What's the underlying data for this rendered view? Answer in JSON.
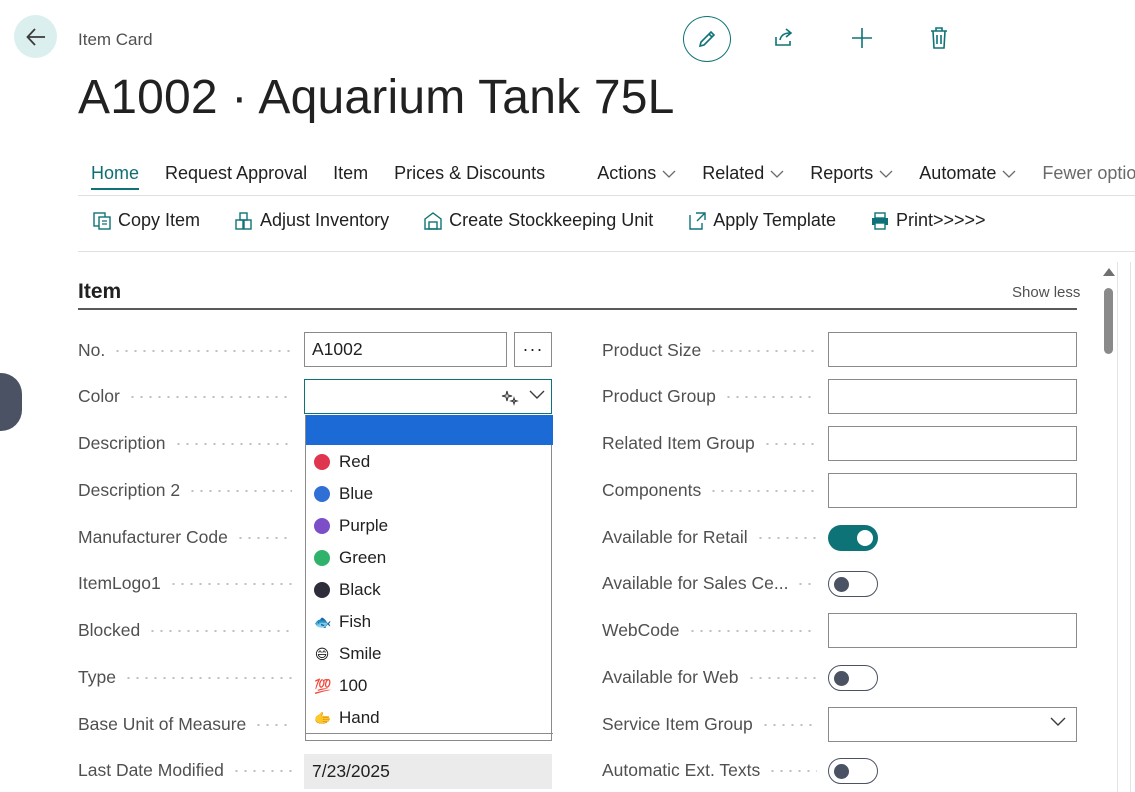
{
  "header": {
    "breadcrumb": "Item Card",
    "title": "A1002 · Aquarium Tank 75L"
  },
  "nav": {
    "tabs": [
      "Home",
      "Request Approval",
      "Item",
      "Prices & Discounts"
    ],
    "menus": [
      "Actions",
      "Related",
      "Reports",
      "Automate"
    ],
    "fewer": "Fewer options"
  },
  "actions": [
    "Copy Item",
    "Adjust Inventory",
    "Create Stockkeeping Unit",
    "Apply Template",
    "Print>>>>>"
  ],
  "section": {
    "title": "Item",
    "toggle_label": "Show less"
  },
  "left_fields": {
    "no": {
      "label": "No.",
      "value": "A1002"
    },
    "color": {
      "label": "Color",
      "value": ""
    },
    "description": {
      "label": "Description"
    },
    "description2": {
      "label": "Description 2"
    },
    "manufacturer": {
      "label": "Manufacturer Code"
    },
    "itemlogo": {
      "label": "ItemLogo1"
    },
    "blocked": {
      "label": "Blocked"
    },
    "type": {
      "label": "Type"
    },
    "base_uom": {
      "label": "Base Unit of Measure"
    },
    "last_modified": {
      "label": "Last Date Modified",
      "value": "7/23/2025"
    }
  },
  "assist": "···",
  "dropdown": {
    "options": [
      {
        "label": "Red",
        "color": "#e0354f"
      },
      {
        "label": "Blue",
        "color": "#2f6fd6"
      },
      {
        "label": "Purple",
        "color": "#7c4fc9"
      },
      {
        "label": "Green",
        "color": "#2fb36b"
      },
      {
        "label": "Black",
        "color": "#2e2e3a"
      },
      {
        "label": "Fish",
        "glyph": "🐟"
      },
      {
        "label": "Smile",
        "glyph": "😄"
      },
      {
        "label": "100",
        "glyph": "💯"
      },
      {
        "label": "Hand",
        "glyph": "🫱"
      }
    ]
  },
  "right_fields": {
    "product_size": {
      "label": "Product Size",
      "value": ""
    },
    "product_group": {
      "label": "Product Group",
      "value": ""
    },
    "related_group": {
      "label": "Related Item Group",
      "value": ""
    },
    "components": {
      "label": "Components",
      "value": ""
    },
    "avail_retail": {
      "label": "Available for Retail",
      "on": true
    },
    "avail_sales": {
      "label": "Available for Sales Ce...",
      "on": false
    },
    "webcode": {
      "label": "WebCode",
      "value": ""
    },
    "avail_web": {
      "label": "Available for Web",
      "on": false
    },
    "service_group": {
      "label": "Service Item Group",
      "value": ""
    },
    "auto_ext": {
      "label": "Automatic Ext. Texts",
      "on": false
    }
  },
  "colors": {
    "accent": "#0e7377",
    "highlight": "#1b6ad6"
  }
}
